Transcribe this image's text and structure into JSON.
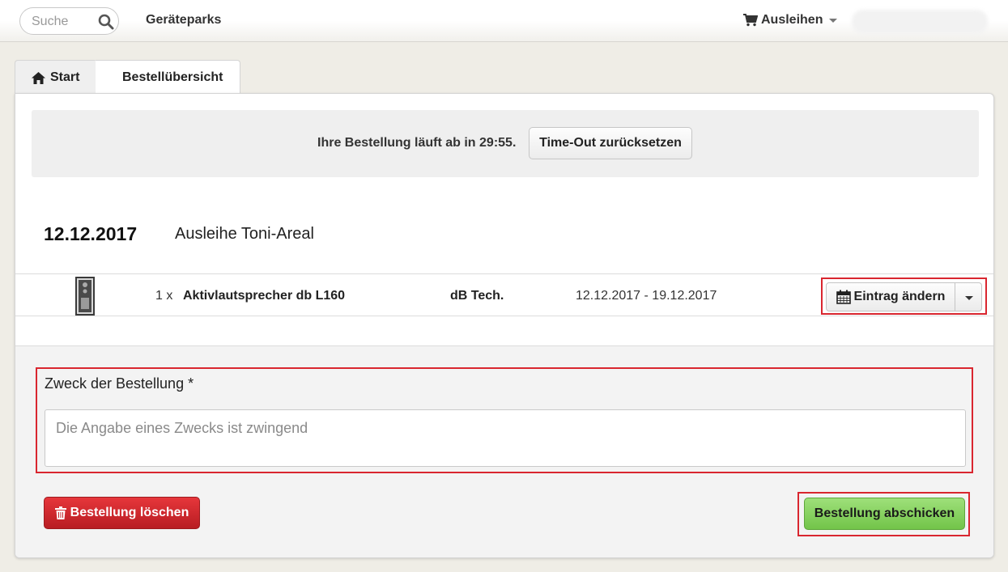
{
  "navbar": {
    "search_placeholder": "Suche",
    "link_label": "Geräteparks",
    "cart_label": "Ausleihen"
  },
  "breadcrumb": {
    "home_label": "Start",
    "current_label": "Bestellübersicht"
  },
  "timeout": {
    "message": "Ihre Bestellung läuft ab in 29:55.",
    "reset_label": "Time-Out zurücksetzen"
  },
  "order": {
    "date": "12.12.2017",
    "name": "Ausleihe Toni-Areal",
    "items": [
      {
        "quantity": "1 x",
        "name": "Aktivlautsprecher db L160",
        "brand": "dB Tech.",
        "period": "12.12.2017 - 19.12.2017",
        "edit_label": "Eintrag ändern"
      }
    ]
  },
  "form": {
    "purpose_label": "Zweck der Bestellung *",
    "purpose_placeholder": "Die Angabe eines Zwecks ist zwingend",
    "delete_label": "Bestellung löschen",
    "submit_label": "Bestellung abschicken"
  },
  "colors": {
    "highlight_frame": "#d9262f",
    "danger": "#c9262b",
    "success": "#80d05a",
    "background": "#efede6"
  }
}
